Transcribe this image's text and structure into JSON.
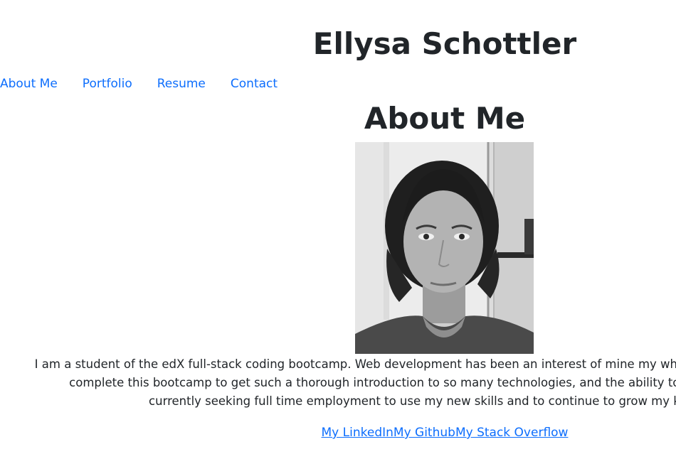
{
  "header": {
    "title": "Ellysa Schottler"
  },
  "nav": {
    "items": [
      {
        "label": "About Me"
      },
      {
        "label": "Portfolio"
      },
      {
        "label": "Resume"
      },
      {
        "label": "Contact"
      }
    ]
  },
  "main": {
    "heading": "About Me",
    "photo_alt": "Photo of Ellysa Schottler",
    "bio": "I am a student of the edX full-stack coding bootcamp. Web development has been an interest of mine my whole life, and I am so excited to complete this bootcamp to get such a thorough introduction to so many technologies, and the ability to build applications. I am currently seeking full time employment to use my new skills and to continue to grow my knowledge.",
    "bio_lines": [
      "I am a student of the edX full-stack coding bootcamp. Web development has been an interest of mine my whole life, and I am so excited to",
      "complete this bootcamp to get such a thorough introduction to so many technologies, and the ability to build applications. I am",
      "currently seeking full time employment to use my new skills and to continue to grow my knowledge."
    ],
    "links": [
      {
        "label": "My LinkedIn"
      },
      {
        "label": "My Github"
      },
      {
        "label": "My Stack Overflow"
      }
    ]
  },
  "colors": {
    "link": "#0d6efd",
    "text": "#212529",
    "background": "#ffffff"
  }
}
